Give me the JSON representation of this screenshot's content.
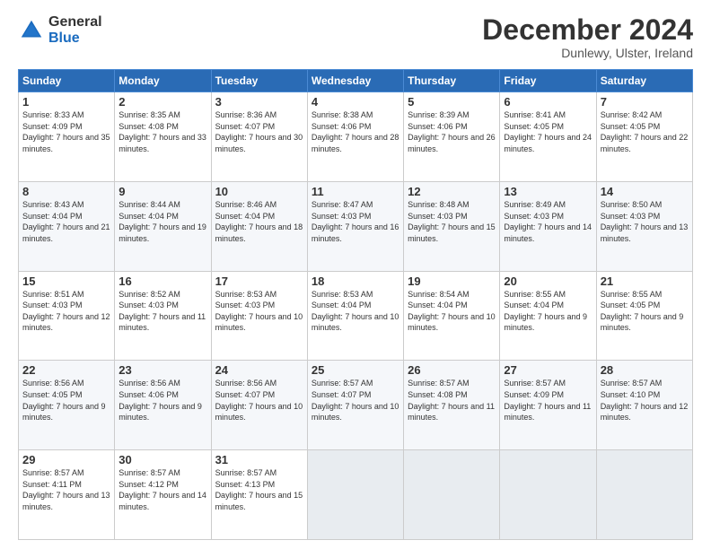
{
  "logo": {
    "general": "General",
    "blue": "Blue"
  },
  "header": {
    "month": "December 2024",
    "location": "Dunlewy, Ulster, Ireland"
  },
  "weekdays": [
    "Sunday",
    "Monday",
    "Tuesday",
    "Wednesday",
    "Thursday",
    "Friday",
    "Saturday"
  ],
  "weeks": [
    [
      {
        "day": "1",
        "sunrise": "8:33 AM",
        "sunset": "4:09 PM",
        "daylight": "7 hours and 35 minutes."
      },
      {
        "day": "2",
        "sunrise": "8:35 AM",
        "sunset": "4:08 PM",
        "daylight": "7 hours and 33 minutes."
      },
      {
        "day": "3",
        "sunrise": "8:36 AM",
        "sunset": "4:07 PM",
        "daylight": "7 hours and 30 minutes."
      },
      {
        "day": "4",
        "sunrise": "8:38 AM",
        "sunset": "4:06 PM",
        "daylight": "7 hours and 28 minutes."
      },
      {
        "day": "5",
        "sunrise": "8:39 AM",
        "sunset": "4:06 PM",
        "daylight": "7 hours and 26 minutes."
      },
      {
        "day": "6",
        "sunrise": "8:41 AM",
        "sunset": "4:05 PM",
        "daylight": "7 hours and 24 minutes."
      },
      {
        "day": "7",
        "sunrise": "8:42 AM",
        "sunset": "4:05 PM",
        "daylight": "7 hours and 22 minutes."
      }
    ],
    [
      {
        "day": "8",
        "sunrise": "8:43 AM",
        "sunset": "4:04 PM",
        "daylight": "7 hours and 21 minutes."
      },
      {
        "day": "9",
        "sunrise": "8:44 AM",
        "sunset": "4:04 PM",
        "daylight": "7 hours and 19 minutes."
      },
      {
        "day": "10",
        "sunrise": "8:46 AM",
        "sunset": "4:04 PM",
        "daylight": "7 hours and 18 minutes."
      },
      {
        "day": "11",
        "sunrise": "8:47 AM",
        "sunset": "4:03 PM",
        "daylight": "7 hours and 16 minutes."
      },
      {
        "day": "12",
        "sunrise": "8:48 AM",
        "sunset": "4:03 PM",
        "daylight": "7 hours and 15 minutes."
      },
      {
        "day": "13",
        "sunrise": "8:49 AM",
        "sunset": "4:03 PM",
        "daylight": "7 hours and 14 minutes."
      },
      {
        "day": "14",
        "sunrise": "8:50 AM",
        "sunset": "4:03 PM",
        "daylight": "7 hours and 13 minutes."
      }
    ],
    [
      {
        "day": "15",
        "sunrise": "8:51 AM",
        "sunset": "4:03 PM",
        "daylight": "7 hours and 12 minutes."
      },
      {
        "day": "16",
        "sunrise": "8:52 AM",
        "sunset": "4:03 PM",
        "daylight": "7 hours and 11 minutes."
      },
      {
        "day": "17",
        "sunrise": "8:53 AM",
        "sunset": "4:03 PM",
        "daylight": "7 hours and 10 minutes."
      },
      {
        "day": "18",
        "sunrise": "8:53 AM",
        "sunset": "4:04 PM",
        "daylight": "7 hours and 10 minutes."
      },
      {
        "day": "19",
        "sunrise": "8:54 AM",
        "sunset": "4:04 PM",
        "daylight": "7 hours and 10 minutes."
      },
      {
        "day": "20",
        "sunrise": "8:55 AM",
        "sunset": "4:04 PM",
        "daylight": "7 hours and 9 minutes."
      },
      {
        "day": "21",
        "sunrise": "8:55 AM",
        "sunset": "4:05 PM",
        "daylight": "7 hours and 9 minutes."
      }
    ],
    [
      {
        "day": "22",
        "sunrise": "8:56 AM",
        "sunset": "4:05 PM",
        "daylight": "7 hours and 9 minutes."
      },
      {
        "day": "23",
        "sunrise": "8:56 AM",
        "sunset": "4:06 PM",
        "daylight": "7 hours and 9 minutes."
      },
      {
        "day": "24",
        "sunrise": "8:56 AM",
        "sunset": "4:07 PM",
        "daylight": "7 hours and 10 minutes."
      },
      {
        "day": "25",
        "sunrise": "8:57 AM",
        "sunset": "4:07 PM",
        "daylight": "7 hours and 10 minutes."
      },
      {
        "day": "26",
        "sunrise": "8:57 AM",
        "sunset": "4:08 PM",
        "daylight": "7 hours and 11 minutes."
      },
      {
        "day": "27",
        "sunrise": "8:57 AM",
        "sunset": "4:09 PM",
        "daylight": "7 hours and 11 minutes."
      },
      {
        "day": "28",
        "sunrise": "8:57 AM",
        "sunset": "4:10 PM",
        "daylight": "7 hours and 12 minutes."
      }
    ],
    [
      {
        "day": "29",
        "sunrise": "8:57 AM",
        "sunset": "4:11 PM",
        "daylight": "7 hours and 13 minutes."
      },
      {
        "day": "30",
        "sunrise": "8:57 AM",
        "sunset": "4:12 PM",
        "daylight": "7 hours and 14 minutes."
      },
      {
        "day": "31",
        "sunrise": "8:57 AM",
        "sunset": "4:13 PM",
        "daylight": "7 hours and 15 minutes."
      },
      null,
      null,
      null,
      null
    ]
  ]
}
